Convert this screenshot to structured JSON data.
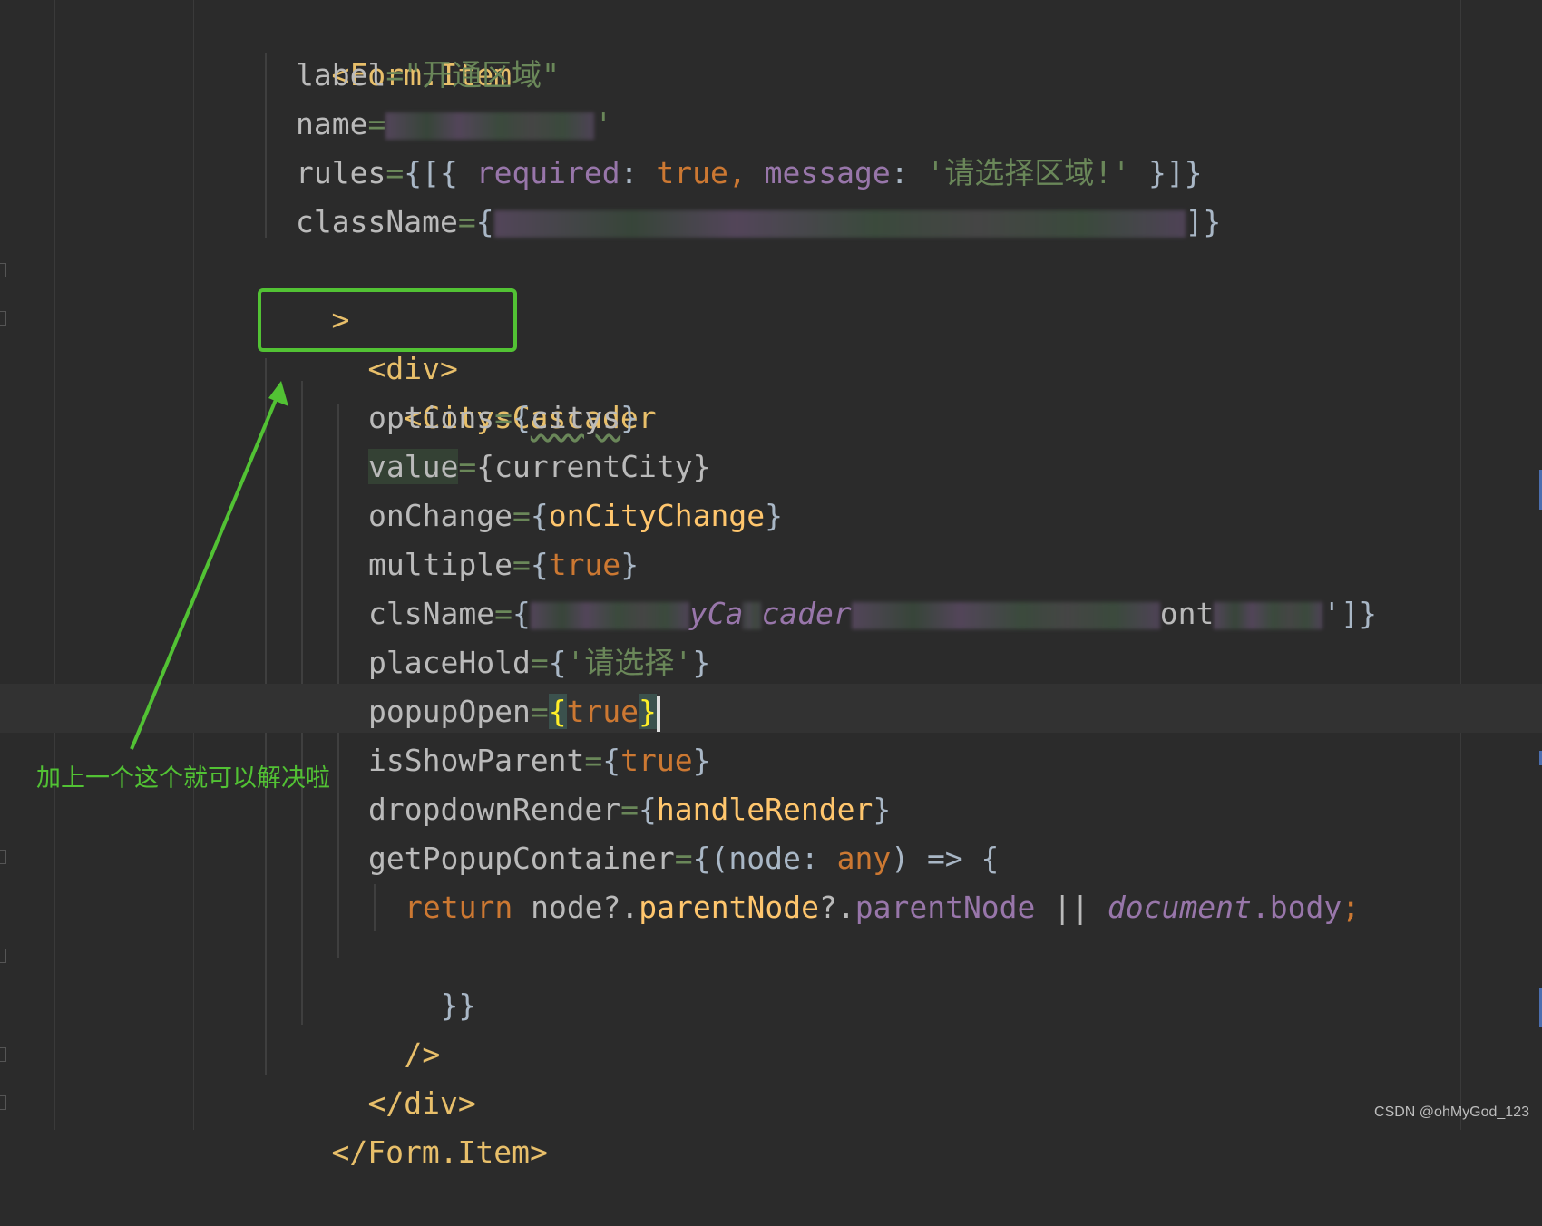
{
  "lines": {
    "l1_tag": "<Form.Item",
    "l2_attr": "label",
    "l2_value": "\"开通区域\"",
    "l3_attr": "name",
    "l3_quote": "'",
    "l4_attr": "rules",
    "l4_open": "{[{ ",
    "l4_required": "required",
    "l4_colon1": ": ",
    "l4_true": "true",
    "l4_comma": ", ",
    "l4_message": "message",
    "l4_colon2": ": ",
    "l4_msg_value": "'请选择区域!'",
    "l4_close": " }]}",
    "l5_attr": "className",
    "l5_open": "{",
    "l5_close": "]}",
    "l6_gt": ">",
    "l7_div": "<div>",
    "l8_tag": "<CitysCascader",
    "l9_attr": "options",
    "l9_open": "{",
    "l9_var": "citys",
    "l9_close": "}",
    "l10_attr": "value",
    "l10_value": "{currentCity}",
    "l11_attr": "onChange",
    "l11_open": "{",
    "l11_method": "onCityChange",
    "l11_close": "}",
    "l12_attr": "multiple",
    "l12_open": "{",
    "l12_true": "true",
    "l12_close": "}",
    "l13_attr": "clsName",
    "l13_open": "{",
    "l13_italic": "yCa",
    "l13_italic2": "cader",
    "l13_tail": "ont",
    "l13_close": "']}",
    "l14_attr": "placeHold",
    "l14_open": "{",
    "l14_value": "'请选择'",
    "l14_close": "}",
    "l15_attr": "popupOpen",
    "l15_open": "{",
    "l15_true": "true",
    "l15_close": "}",
    "l16_attr": "isShowParent",
    "l16_open": "{",
    "l16_true": "true",
    "l16_close": "}",
    "l17_attr": "dropdownRender",
    "l17_open": "{",
    "l17_method": "handleRender",
    "l17_close": "}",
    "l18_attr": "getPopupContainer",
    "l18_open": "{(node: ",
    "l18_any": "any",
    "l18_close": ") => {",
    "l19_return": "return ",
    "l19_node": "node?.",
    "l19_parent1": "parentNode",
    "l19_q": "?.",
    "l19_parent2": "parentNode",
    "l19_or": " || ",
    "l19_document": "document",
    "l19_body": ".body",
    "l19_semi": ";",
    "l20_close": "}}",
    "l21_selfclose": "/>",
    "l22_closediv": "</div>",
    "l23_closetag": "</Form.Item>",
    "eq": "="
  },
  "annotation": {
    "text": "加上一个这个就可以解决啦",
    "color": "#52c234"
  },
  "watermark": "CSDN @ohMyGod_123",
  "colors": {
    "background": "#2b2b2b",
    "tag": "#e8bf6a",
    "keyword": "#cc7832",
    "string": "#6a8759",
    "property": "#9876aa",
    "method": "#ffc66d",
    "text": "#a9b7c6"
  }
}
